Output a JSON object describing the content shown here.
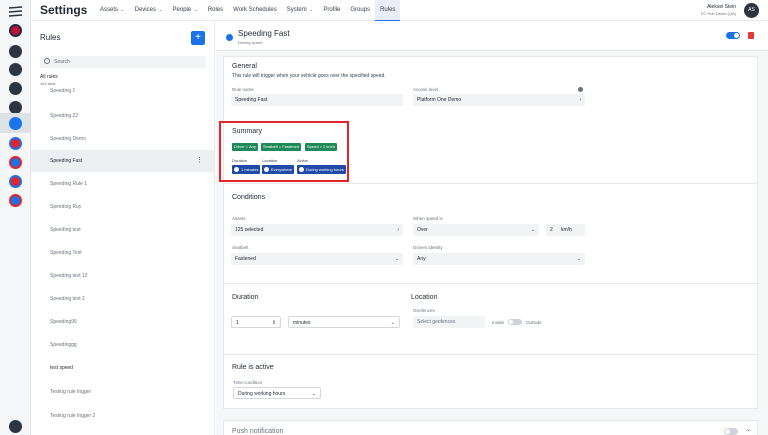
{
  "app": {
    "title": "Settings"
  },
  "nav": [
    {
      "label": "Assets",
      "dropdown": true
    },
    {
      "label": "Devices",
      "dropdown": true
    },
    {
      "label": "People",
      "dropdown": true
    },
    {
      "label": "Roles",
      "dropdown": false
    },
    {
      "label": "Work Schedules",
      "dropdown": false
    },
    {
      "label": "System",
      "dropdown": true
    },
    {
      "label": "Profile",
      "dropdown": false
    },
    {
      "label": "Groups",
      "dropdown": false
    },
    {
      "label": "Rules",
      "dropdown": false,
      "active": true
    }
  ],
  "user": {
    "name": "Aleksei Stein",
    "org": "FC Hub Demo (QA)",
    "initials": "AS"
  },
  "rules_panel": {
    "title": "Rules",
    "add_label": "+",
    "search_placeholder": "Search",
    "all_rules_label": "All rules",
    "all_rules_count": "164 total",
    "items": [
      {
        "label": "Speeding 1"
      },
      {
        "label": "Speeding 22"
      },
      {
        "label": "Speeding Demo"
      },
      {
        "label": "Speeding Fast",
        "selected": true
      },
      {
        "label": "Speeding Rule 1"
      },
      {
        "label": "Speeding Ruy"
      },
      {
        "label": "Speeding test"
      },
      {
        "label": "Speeding Test"
      },
      {
        "label": "Speeding text 12"
      },
      {
        "label": "Speeding text 2"
      },
      {
        "label": "Speeding99"
      },
      {
        "label": "Speedinggg"
      },
      {
        "label": "test speed",
        "dark": true
      },
      {
        "label": "Testing rule trigger"
      },
      {
        "label": "Testing rule trigger 2"
      }
    ]
  },
  "rule": {
    "title": "Speeding Fast",
    "subtitle": "Driving speed",
    "enabled": true
  },
  "general": {
    "title": "General",
    "description": "This rule will trigger when your vehicle goes over the specified speed.",
    "name_label": "Rule name",
    "name_value": "Speeding Fast",
    "access_label": "Access level",
    "access_value": "Platform One Demo"
  },
  "summary": {
    "title": "Summary",
    "chips": [
      "Driver = Any",
      "Seatbelt = Fastened",
      "Speed > 2 km/h"
    ],
    "duration_label": "Duration",
    "duration_value": "1 minutes",
    "location_label": "Location",
    "location_value": "Everywhere",
    "active_label": "Active",
    "active_value": "During working hours"
  },
  "conditions": {
    "title": "Conditions",
    "assets_label": "Assets",
    "assets_value": "125 selected",
    "when_speed_label": "When speed is",
    "when_speed_value": "Over",
    "speed_number": "2",
    "speed_unit": "km/h",
    "seatbelt_label": "Seatbelt",
    "seatbelt_value": "Fastened",
    "drivers_label": "Drivers identity",
    "drivers_value": "Any"
  },
  "duration": {
    "title": "Duration",
    "number": "1",
    "unit": "minutes"
  },
  "location": {
    "title": "Location",
    "geofences_label": "Geofences",
    "geofences_placeholder": "Select geofences",
    "inside_label": "Inside",
    "outside_label": "Outside"
  },
  "rule_active": {
    "title": "Rule is active",
    "time_label": "Time condition",
    "time_value": "During working hours"
  },
  "push": {
    "title": "Push notification"
  }
}
